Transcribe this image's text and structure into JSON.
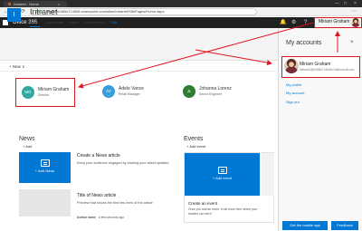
{
  "browser": {
    "tab_title": "Intranet - Home",
    "tab_close": "×",
    "back_glyph": "←",
    "forward_glyph": "→",
    "reload_glyph": "⟳",
    "url_secure": "Bing",
    "url_rest": "https://m365x714608.sharepoint.com/sites/Intranet/SitePages/Home.aspx",
    "window_controls": [
      "—",
      "□",
      "×"
    ],
    "menu_glyph": "⋯"
  },
  "suite_bar": {
    "brand": "Office 365",
    "bell_glyph": "🔔",
    "gear_glyph": "⚙",
    "help_glyph": "?",
    "user_name": "Miriam Graham"
  },
  "site": {
    "logo_letter": "I",
    "title": "Intranet",
    "nav": [
      {
        "label": "Home",
        "active": true
      },
      {
        "label": "Documents",
        "active": false
      },
      {
        "label": "Pages",
        "active": false
      },
      {
        "label": "Site contents",
        "active": false
      }
    ],
    "edit_label": "Edit",
    "new_label": "+ New ∨"
  },
  "people": [
    {
      "initials": "MG",
      "name": "Miriam Graham",
      "title": "Director",
      "color": "#2fa9a0"
    },
    {
      "initials": "AV",
      "name": "Adele Vance",
      "title": "Retail Manager",
      "color": "#3a9ed8"
    },
    {
      "initials": "JL",
      "name": "Johanna Lorenz",
      "title": "Senior Engineer",
      "color": "#2e7d32"
    }
  ],
  "news": {
    "heading": "News",
    "add_label": "+ Add",
    "tile_label": "+ Add News",
    "item1_title": "Create a News article",
    "item1_desc": "Keep your audience engaged by sharing your latest updates.",
    "item2_title": "Title of News article",
    "item2_desc": "Preview that shows the first few lines of the article",
    "item2_author": "Author name",
    "item2_date": "a few seconds ago"
  },
  "events": {
    "heading": "Events",
    "add_label": "+ Add event",
    "tile_label": "+ Add event",
    "card_title": "Create an event",
    "card_desc": "Once you add an event, it will show here where your readers can see it"
  },
  "accounts_panel": {
    "title": "My accounts",
    "close_glyph": "×",
    "account_name": "Miriam Graham",
    "account_email": "MiriamG@M365x714608.OnMicrosoft.com",
    "my_profile": "My profile",
    "my_account": "My account",
    "sign_out": "Sign out",
    "mobile_app_button": "Get the mobile app",
    "feedback_button": "Feedback"
  },
  "colors": {
    "accent": "#0078d4",
    "highlight_red": "#e0141f",
    "suite_bar": "#212121"
  }
}
